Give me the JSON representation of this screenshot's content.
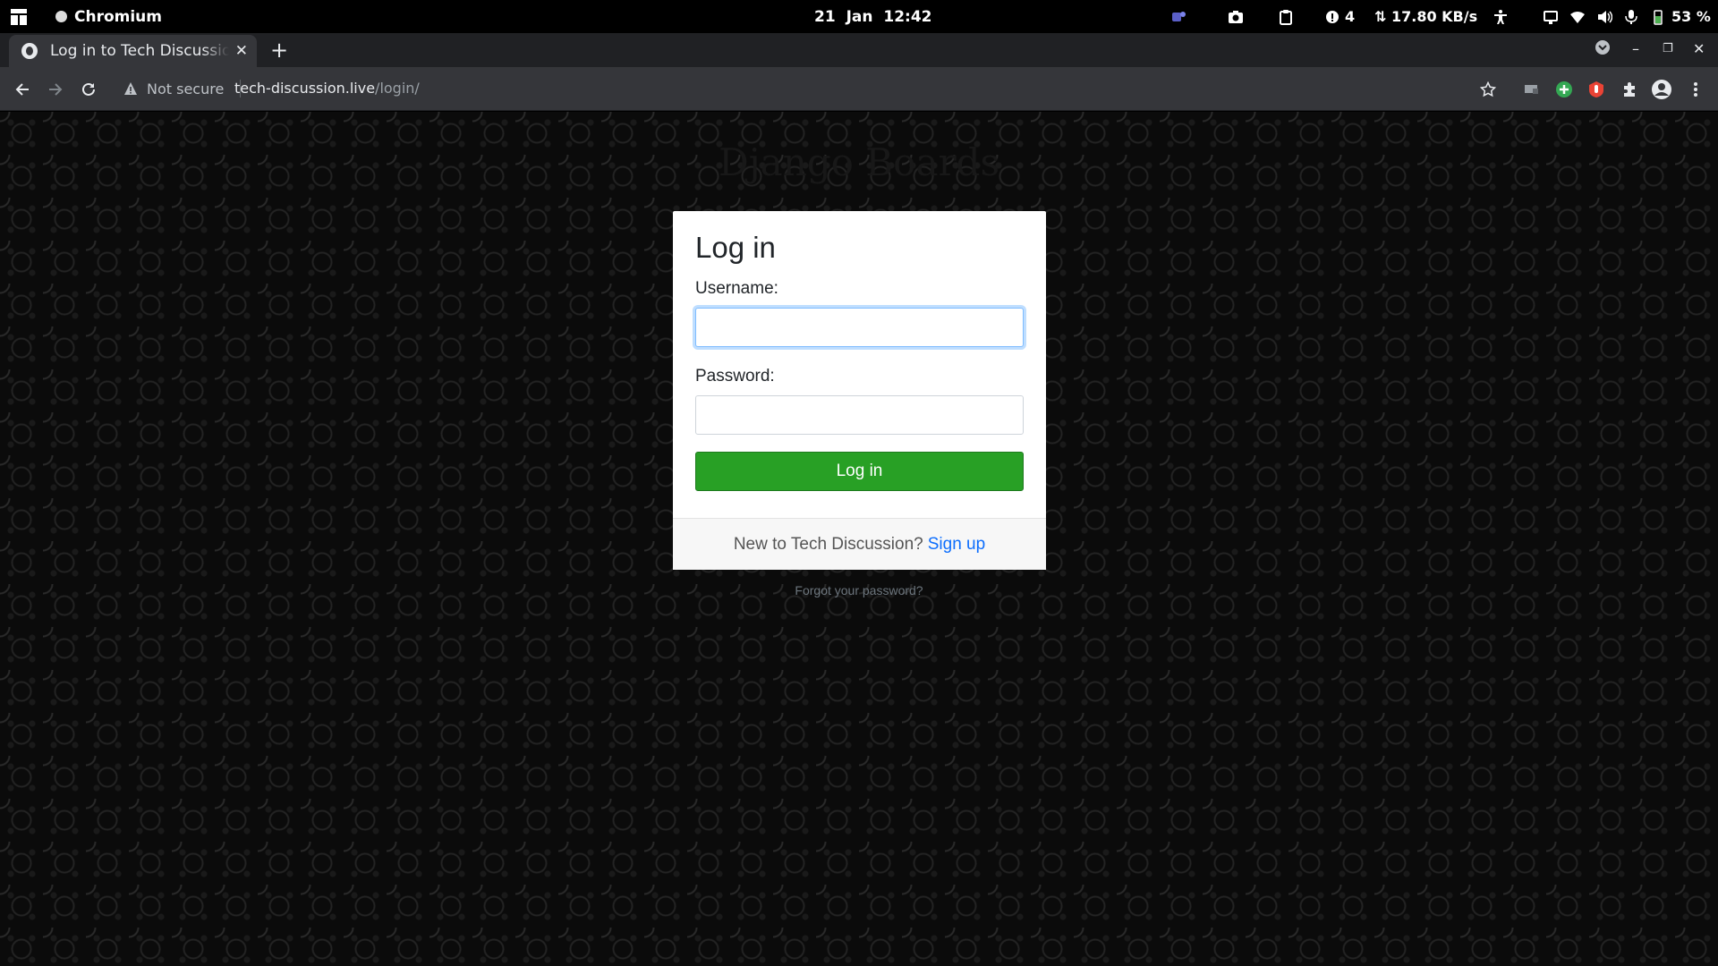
{
  "system_bar": {
    "app_name": "Chromium",
    "clock": "21 Jan  12:42",
    "notification_count": "4",
    "network_speed": "⇅ 17.80 KB/s",
    "battery": "53 %"
  },
  "browser": {
    "tab_title": "Log in to Tech Discussion",
    "security_label": "Not secure",
    "url_domain": "tech-discussion.live",
    "url_path": "/login/"
  },
  "page": {
    "brand": "Django Boards",
    "heading": "Log in",
    "username_label": "Username:",
    "username_value": "",
    "password_label": "Password:",
    "password_value": "",
    "submit_label": "Log in",
    "signup_prompt": "New to Tech Discussion?",
    "signup_link": "Sign up",
    "forgot_link": "Forgot your password?"
  },
  "colors": {
    "button_green": "#28a025",
    "link_blue": "#0d6efd",
    "focus_ring": "#80bdff"
  }
}
